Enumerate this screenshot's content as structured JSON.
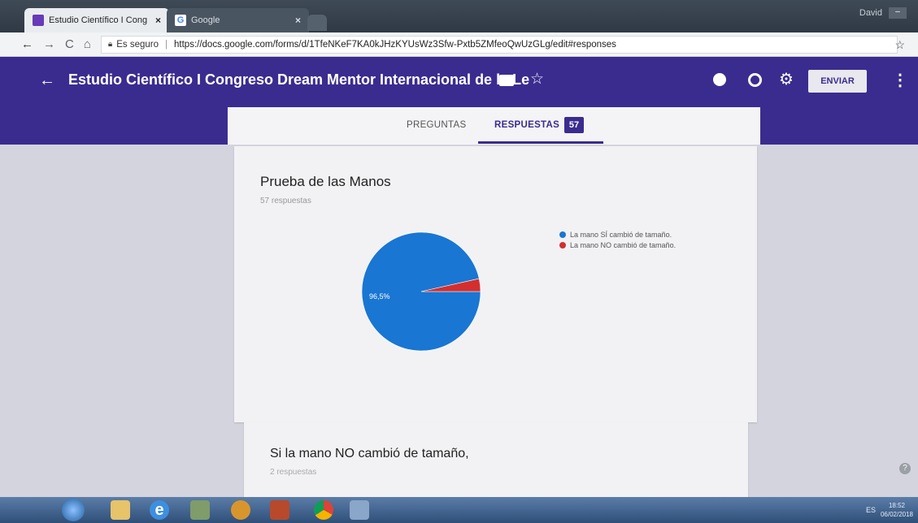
{
  "browser": {
    "tabs": [
      {
        "title": "Estudio Científico I Cong",
        "close": "×"
      },
      {
        "title": "Google",
        "close": "×"
      }
    ],
    "user": "David",
    "address": {
      "secure_label": "Es seguro",
      "url": "https://docs.google.com/forms/d/1TfeNKeF7KA0kJHzKYUsWz3Sfw-Pxtb5ZMfeoQwUzGLg/edit#responses"
    }
  },
  "forms_header": {
    "title": "Estudio Científico I Congreso Dream Mentor Internacional de la Le",
    "send_label": "ENVIAR"
  },
  "tabs": {
    "questions": "PREGUNTAS",
    "responses": "RESPUESTAS",
    "response_count": "57"
  },
  "question1": {
    "title": "Prueba de las Manos",
    "count_label": "57 respuestas"
  },
  "question2": {
    "title": "Si la mano NO cambió de tamaño,",
    "count_label": "2 respuestas"
  },
  "chart_data": {
    "type": "pie",
    "categories": [
      "La mano SÍ cambió de tamaño.",
      "La mano NO cambió de tamaño."
    ],
    "values": [
      96.5,
      3.5
    ],
    "colors": [
      "#1976d2",
      "#d32f2f"
    ],
    "data_labels": [
      "96,5%",
      ""
    ],
    "legend_position": "right"
  },
  "taskbar": {
    "tray_lang": "ES",
    "time": "18:52",
    "date": "06/02/2018"
  },
  "colors": {
    "form_accent": "#3a2c8f",
    "pie_primary": "#1976d2",
    "pie_secondary": "#d32f2f"
  }
}
